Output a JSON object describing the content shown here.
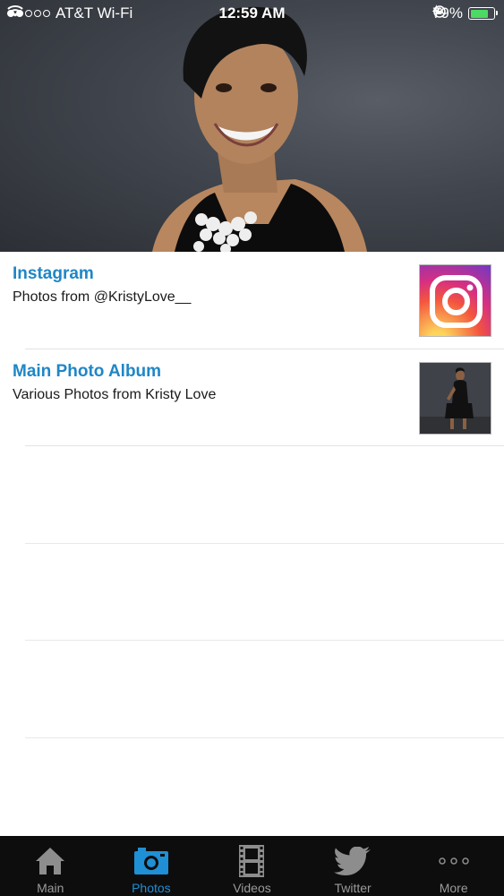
{
  "status_bar": {
    "carrier": "AT&T Wi-Fi",
    "time": "12:59 AM",
    "battery_percent": "79%",
    "battery_level": 0.79,
    "signal_strength": 2
  },
  "list": {
    "items": [
      {
        "title": "Instagram",
        "subtitle": "Photos from @KristyLove__",
        "thumbnail": "instagram-logo"
      },
      {
        "title": "Main Photo Album",
        "subtitle": "Various Photos from Kristy Love",
        "thumbnail": "album-photo"
      }
    ]
  },
  "tab_bar": {
    "tabs": [
      {
        "label": "Main",
        "icon": "home-icon",
        "active": false
      },
      {
        "label": "Photos",
        "icon": "camera-icon",
        "active": true
      },
      {
        "label": "Videos",
        "icon": "film-icon",
        "active": false
      },
      {
        "label": "Twitter",
        "icon": "twitter-bird-icon",
        "active": false
      },
      {
        "label": "More",
        "icon": "more-dots-icon",
        "active": false
      }
    ]
  },
  "colors": {
    "accent": "#1f86c7",
    "active_tab": "#1f8fd6",
    "tab_bar_bg": "#0d0d0d",
    "battery_green": "#4cd964"
  }
}
